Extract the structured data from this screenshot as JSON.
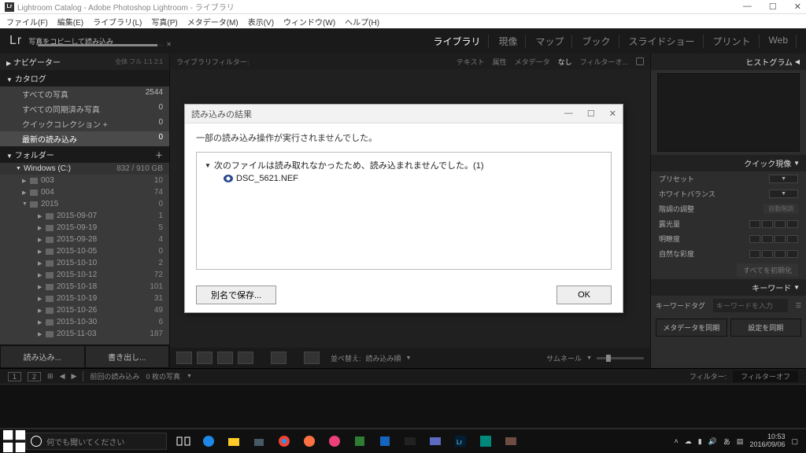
{
  "window": {
    "title": "Lightroom Catalog - Adobe Photoshop Lightroom - ライブラリ",
    "logo_badge": "Lr"
  },
  "menubar": [
    "ファイル(F)",
    "編集(E)",
    "ライブラリ(L)",
    "写真(P)",
    "メタデータ(M)",
    "表示(V)",
    "ウィンドウ(W)",
    "ヘルプ(H)"
  ],
  "lr": {
    "logo": "Lr",
    "import_status": "写真をコピーして読み込み"
  },
  "modules": {
    "items": [
      "ライブラリ",
      "現像",
      "マップ",
      "ブック",
      "スライドショー",
      "プリント",
      "Web"
    ],
    "active": 0
  },
  "left": {
    "navigator": {
      "label": "ナビゲーター",
      "sub": "全体   フル   1:1   2:1"
    },
    "catalog": {
      "label": "カタログ",
      "rows": [
        {
          "label": "すべての写真",
          "count": "2544"
        },
        {
          "label": "すべての同期済み写真",
          "count": "0"
        },
        {
          "label": "クイックコレクション  +",
          "count": "0"
        },
        {
          "label": "最新の読み込み",
          "count": "0",
          "selected": true
        }
      ]
    },
    "folders": {
      "label": "フォルダー",
      "drive": {
        "name": "Windows (C:)",
        "usage": "832 / 910 GB"
      },
      "rows": [
        {
          "label": "003",
          "count": "10"
        },
        {
          "label": "004",
          "count": "74"
        },
        {
          "label": "2015",
          "count": "0",
          "expanded": true
        },
        {
          "label": "2015-09-07",
          "count": "1",
          "child": true
        },
        {
          "label": "2015-09-19",
          "count": "5",
          "child": true
        },
        {
          "label": "2015-09-28",
          "count": "4",
          "child": true
        },
        {
          "label": "2015-10-05",
          "count": "0",
          "child": true
        },
        {
          "label": "2015-10-10",
          "count": "2",
          "child": true
        },
        {
          "label": "2015-10-12",
          "count": "72",
          "child": true
        },
        {
          "label": "2015-10-18",
          "count": "101",
          "child": true
        },
        {
          "label": "2015-10-19",
          "count": "31",
          "child": true
        },
        {
          "label": "2015-10-26",
          "count": "49",
          "child": true
        },
        {
          "label": "2015-10-30",
          "count": "6",
          "child": true
        },
        {
          "label": "2015-11-03",
          "count": "187",
          "child": true
        }
      ]
    },
    "import_btn": "読み込み...",
    "export_btn": "書き出し..."
  },
  "filterbar": {
    "label": "ライブラリフィルター:",
    "text": "テキスト",
    "attribute": "属性",
    "metadata": "メタデータ",
    "none": "なし",
    "filter_off": "フィルターオ..."
  },
  "toolbar": {
    "sort_swap": "並べ替え:",
    "sort_mode": "読み込み順",
    "thumbnail": "サムネール"
  },
  "right": {
    "histogram": "ヒストグラム",
    "quickdev": "クイック現像",
    "preset": "プリセット",
    "wb": "ホワイトバランス",
    "tone": "階調の調整",
    "exposure": "露光量",
    "clarity": "明瞭度",
    "vibrance": "自然な彩度",
    "reset": "すべてを初期化",
    "keywords": "キーワード",
    "kw_tag": "キーワードタグ",
    "kw_input": "キーワードを入力",
    "sync_meta": "メタデータを同期",
    "sync_settings": "設定を同期"
  },
  "status": {
    "prev_import": "前回の読み込み",
    "count": "0 枚の写真",
    "filter_label": "フィルター:",
    "filter_off": "フィルターオフ"
  },
  "dialog": {
    "title": "読み込みの結果",
    "message": "一部の読み込み操作が実行されませんでした。",
    "list_header": "次のファイルは読み取れなかったため、読み込まれませんでした。(1)",
    "file": "DSC_5621.NEF",
    "save_as": "別名で保存...",
    "ok": "OK"
  },
  "taskbar": {
    "search_placeholder": "何でも聞いてください",
    "time": "10:53",
    "date": "2016/09/06"
  },
  "colors": {
    "accent": "#4a90d9",
    "bg_dark": "#1a1a1a"
  }
}
